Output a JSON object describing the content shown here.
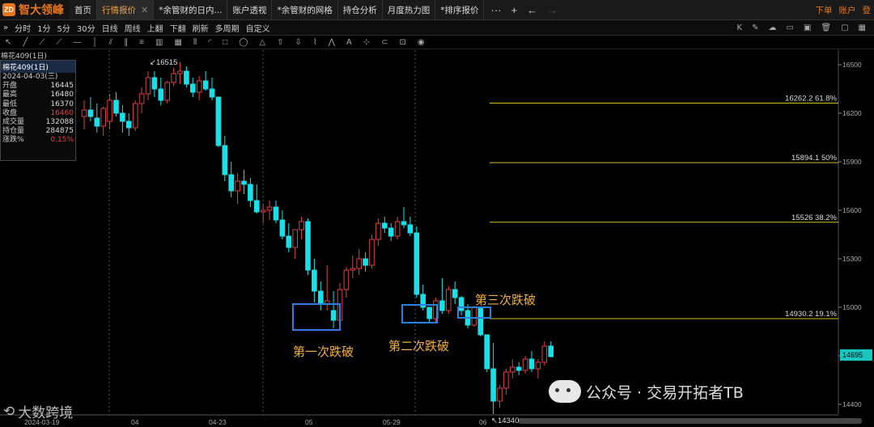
{
  "app": {
    "name": "智大领峰",
    "logo_text": "ZD"
  },
  "tabs": [
    {
      "label": "首页",
      "active": false,
      "closable": false
    },
    {
      "label": "行情报价",
      "active": true,
      "closable": true
    },
    {
      "label": "*余管财的日内...",
      "active": false,
      "closable": false
    },
    {
      "label": "账户透视",
      "active": false,
      "closable": false
    },
    {
      "label": "*余管财的网格",
      "active": false,
      "closable": false
    },
    {
      "label": "持仓分析",
      "active": false,
      "closable": false
    },
    {
      "label": "月度热力图",
      "active": false,
      "closable": false
    },
    {
      "label": "*排序报价",
      "active": false,
      "closable": false
    }
  ],
  "tabbar_right": {
    "more": "···",
    "plus": "+",
    "back": "←",
    "forward": "→",
    "order": "下单",
    "account": "账户",
    "login": "登"
  },
  "toolbar": {
    "expand": "»",
    "periods": [
      "分时",
      "1分",
      "5分",
      "30分",
      "日线",
      "周线",
      "上翻",
      "下翻",
      "刷新",
      "多周期",
      "自定义"
    ],
    "right_label": "K"
  },
  "symbol_title": "棉花409(1日)",
  "info_panel": {
    "header": "棉花409(1日)",
    "date": "2024-04-03(三)",
    "rows": [
      {
        "k": "开盘",
        "v": "16445",
        "red": false
      },
      {
        "k": "最高",
        "v": "16480",
        "red": false
      },
      {
        "k": "最低",
        "v": "16370",
        "red": false
      },
      {
        "k": "收盘",
        "v": "16460",
        "red": true
      },
      {
        "k": "成交量",
        "v": "132088",
        "red": false
      },
      {
        "k": "持仓量",
        "v": "284875",
        "red": false
      },
      {
        "k": "涨跌%",
        "v": "0.15%",
        "red": true
      }
    ]
  },
  "chart_data": {
    "type": "candlestick",
    "y_axis_ticks": [
      16500,
      16200,
      15900,
      15600,
      15300,
      15000,
      14700,
      14400
    ],
    "x_axis_labels": [
      "2024-03-19",
      "04",
      "04-23",
      "05",
      "05-29",
      "06"
    ],
    "high_label": "16515",
    "low_label": "14340",
    "last_price": "14695",
    "fib_levels": [
      {
        "label": "16262.2 61.8%",
        "value": 16262.2
      },
      {
        "label": "15894.1 50%",
        "value": 15894.1
      },
      {
        "label": "15526 38.2%",
        "value": 15526
      },
      {
        "label": "14930.2 19.1%",
        "value": 14930.2
      }
    ],
    "candles": [
      [
        16180,
        16280,
        16100,
        16220
      ],
      [
        16220,
        16300,
        16150,
        16180
      ],
      [
        16170,
        16260,
        16080,
        16120
      ],
      [
        16120,
        16240,
        16060,
        16230
      ],
      [
        16150,
        16320,
        16100,
        16280
      ],
      [
        16280,
        16330,
        16180,
        16200
      ],
      [
        16200,
        16250,
        16080,
        16150
      ],
      [
        16150,
        16200,
        16060,
        16110
      ],
      [
        16110,
        16280,
        16090,
        16260
      ],
      [
        16260,
        16360,
        16200,
        16320
      ],
      [
        16320,
        16460,
        16280,
        16420
      ],
      [
        16420,
        16460,
        16300,
        16350
      ],
      [
        16350,
        16420,
        16250,
        16280
      ],
      [
        16280,
        16400,
        16260,
        16390
      ],
      [
        16390,
        16480,
        16370,
        16445
      ],
      [
        16445,
        16515,
        16380,
        16460
      ],
      [
        16460,
        16490,
        16360,
        16380
      ],
      [
        16380,
        16420,
        16300,
        16330
      ],
      [
        16330,
        16430,
        16280,
        16400
      ],
      [
        16400,
        16460,
        16340,
        16350
      ],
      [
        16350,
        16420,
        16280,
        16300
      ],
      [
        16300,
        16240,
        15990,
        16000
      ],
      [
        16000,
        16060,
        15780,
        15820
      ],
      [
        15820,
        15900,
        15680,
        15720
      ],
      [
        15720,
        15830,
        15640,
        15780
      ],
      [
        15780,
        15850,
        15700,
        15760
      ],
      [
        15760,
        15800,
        15620,
        15660
      ],
      [
        15660,
        15760,
        15580,
        15590
      ],
      [
        15590,
        15640,
        15520,
        15600
      ],
      [
        15600,
        15660,
        15540,
        15620
      ],
      [
        15620,
        15660,
        15520,
        15540
      ],
      [
        15540,
        15600,
        15420,
        15440
      ],
      [
        15440,
        15520,
        15340,
        15370
      ],
      [
        15370,
        15480,
        15300,
        15480
      ],
      [
        15480,
        15560,
        15420,
        15530
      ],
      [
        15530,
        15550,
        15200,
        15230
      ],
      [
        15230,
        15300,
        15030,
        15100
      ],
      [
        15100,
        15160,
        14980,
        15020
      ],
      [
        15020,
        15260,
        14980,
        15040
      ],
      [
        14980,
        15100,
        14870,
        14920
      ],
      [
        14920,
        15150,
        14880,
        15110
      ],
      [
        15110,
        15250,
        15060,
        15230
      ],
      [
        15230,
        15320,
        15180,
        15240
      ],
      [
        15240,
        15360,
        15200,
        15300
      ],
      [
        15300,
        15340,
        15220,
        15260
      ],
      [
        15260,
        15450,
        15240,
        15420
      ],
      [
        15420,
        15550,
        15380,
        15520
      ],
      [
        15520,
        15560,
        15460,
        15490
      ],
      [
        15490,
        15520,
        15410,
        15440
      ],
      [
        15440,
        15560,
        15420,
        15530
      ],
      [
        15530,
        15620,
        15490,
        15510
      ],
      [
        15510,
        15560,
        15440,
        15460
      ],
      [
        15460,
        15500,
        15060,
        15080
      ],
      [
        15080,
        15140,
        14980,
        15000
      ],
      [
        15000,
        14960,
        14900,
        14930
      ],
      [
        14930,
        15060,
        14910,
        15040
      ],
      [
        15040,
        15180,
        14960,
        14980
      ],
      [
        14980,
        15130,
        14960,
        15110
      ],
      [
        15110,
        15160,
        15020,
        15060
      ],
      [
        15060,
        15070,
        14950,
        14980
      ],
      [
        14980,
        15020,
        14870,
        14890
      ],
      [
        14890,
        15010,
        14880,
        15000
      ],
      [
        15000,
        15000,
        14820,
        14830
      ],
      [
        14830,
        14720,
        14600,
        14620
      ],
      [
        14620,
        14780,
        14340,
        14420
      ],
      [
        14420,
        14520,
        14380,
        14500
      ],
      [
        14500,
        14620,
        14460,
        14600
      ],
      [
        14600,
        14680,
        14560,
        14630
      ],
      [
        14630,
        14660,
        14580,
        14610
      ],
      [
        14610,
        14700,
        14590,
        14680
      ],
      [
        14680,
        14730,
        14600,
        14620
      ],
      [
        14620,
        14680,
        14560,
        14660
      ],
      [
        14660,
        14790,
        14640,
        14760
      ],
      [
        14760,
        14790,
        14690,
        14695
      ]
    ],
    "annotations": [
      {
        "label": "第一次跌破"
      },
      {
        "label": "第二次跌破"
      },
      {
        "label": "第三次跌破"
      }
    ]
  },
  "watermarks": {
    "left": "大数跨境",
    "right": "公众号 · 交易开拓者TB"
  },
  "colors": {
    "up": "#e04040",
    "down": "#18e0e8",
    "fib": "#d4c020",
    "annotation": "#f0b040",
    "box": "#2a80e0",
    "accent": "#e8751a"
  }
}
